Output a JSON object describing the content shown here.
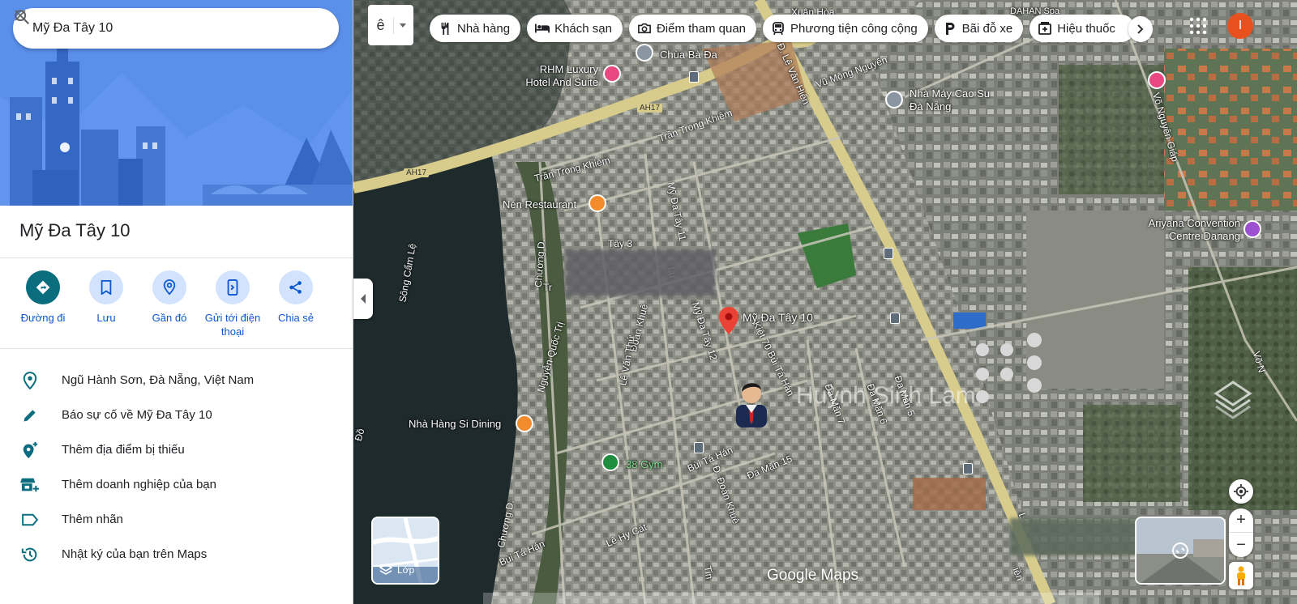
{
  "search": {
    "query": "Mỹ Đa Tây 10"
  },
  "place": {
    "title": "Mỹ Đa Tây 10"
  },
  "actions": [
    {
      "label": "Đường đi",
      "icon": "directions-icon"
    },
    {
      "label": "Lưu",
      "icon": "bookmark-icon"
    },
    {
      "label": "Gần đó",
      "icon": "nearby-icon"
    },
    {
      "label": "Gửi tới điện thoại",
      "icon": "send-to-phone-icon"
    },
    {
      "label": "Chia sẻ",
      "icon": "share-icon"
    }
  ],
  "info": [
    {
      "text": "Ngũ Hành Sơn, Đà Nẵng, Việt Nam",
      "icon": "location-pin-icon"
    },
    {
      "text": "Báo sự cố về Mỹ Đa Tây 10",
      "icon": "edit-pencil-icon"
    },
    {
      "text": "Thêm địa điểm bị thiếu",
      "icon": "add-place-icon"
    },
    {
      "text": "Thêm doanh nghiệp của bạn",
      "icon": "add-business-icon"
    },
    {
      "text": "Thêm nhãn",
      "icon": "label-icon"
    },
    {
      "text": "Nhật ký của bạn trên Maps",
      "icon": "history-icon"
    }
  ],
  "map": {
    "lang_selector": "ê",
    "chips": [
      {
        "label": "Nhà hàng",
        "icon": "restaurant-icon"
      },
      {
        "label": "Khách sạn",
        "icon": "hotel-icon"
      },
      {
        "label": "Điểm tham quan",
        "icon": "camera-icon"
      },
      {
        "label": "Phương tiện công cộng",
        "icon": "transit-icon"
      },
      {
        "label": "Bãi đỗ xe",
        "icon": "parking-icon"
      },
      {
        "label": "Hiệu thuốc",
        "icon": "pharmacy-icon"
      }
    ],
    "account_initial": "I",
    "pin_label": "Mỹ Đa Tây 10",
    "watermark": "Huỳnh Sinh Lam",
    "layers_label": "Lớp",
    "logo": "Google Maps",
    "pois": {
      "rhm": "RHM Luxury Hotel And Suite",
      "chua": "Chùa Bà Đa",
      "nha_may": "Nhà Máy Cao Su Đà Nẵng",
      "nen": "Nén Restaurant",
      "ariyana": "Ariyana Convention Centre Danang",
      "si_dining": "Nhà Hàng Si Dining",
      "gym": "38 Gym",
      "dahan": "DAHAN Spa"
    },
    "roads": {
      "ah17a": "AH17",
      "ah17b": "AH17",
      "tran_trong_khiem_1": "Trần Trọng Khiêm",
      "tran_trong_khiem_2": "Trần Trọng Khiêm",
      "vu_mong_nguyen": "Vũ Mộng Nguyên",
      "le_van_hien": "Đ. Lê Văn Hiến",
      "xuan_hoa": "Xuân Hòa",
      "vo_nguyen_giap": "Võ Nguyên Giáp",
      "song_cam_le": "Sông Cẩm Lệ",
      "chuong_d1": "Chương D.",
      "chuong_d2": "Chương D.",
      "nguyen_quoc_tri": "Nguyễn Quốc Trị",
      "doan_khue": "Đoàn Khuê",
      "le_van_thu": "Lê Văn Thứ",
      "my_da_tay_11": "Mỹ Đa Tây 11",
      "my_da_tay_12": "Mỹ Đa Tây 12",
      "kiet_70": "Kiệt 70 Bùi Tá Hán",
      "da_man_7": "Đa Mặn 7",
      "da_man_6": "Đa Mặn 6",
      "da_man_5": "Đa Mặn 5",
      "bui_ta_han_1": "Bùi Tá Hán",
      "bui_ta_han_2": "Bùi Tá Hán",
      "da_man_15": "Đa Mặn 15",
      "d_doan_khue": "Đ. Đoàn Khuê",
      "le_hy_cat": "Lê Hy Cát",
      "tay_3": "Tây 3",
      "vo_n": "Võ N",
      "do": "Đồ",
      "tr": "Tr",
      "luu": "Lư",
      "tinh": "Tin",
      "lien": "iền",
      "lu": "L"
    }
  },
  "colors": {
    "primary_action": "#0b6e7f",
    "action_bg": "#d3e3fd",
    "link": "#0b57d0",
    "pin": "#ea4335",
    "avatar": "#e8501e"
  }
}
